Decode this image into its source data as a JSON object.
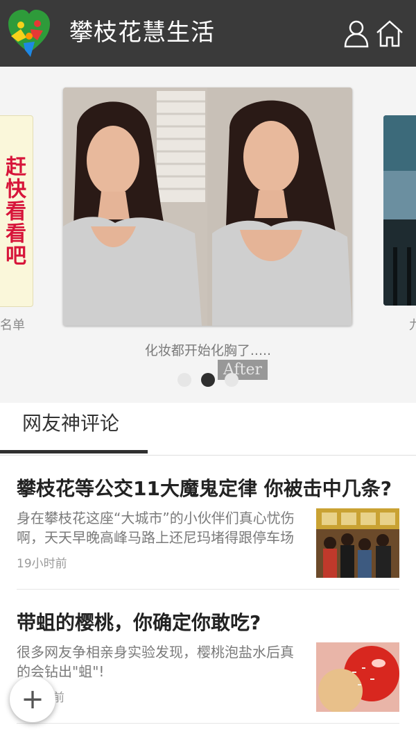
{
  "header": {
    "title": "攀枝花慧生活",
    "logo_icon": "family-heart-logo",
    "user_icon": "user-icon",
    "home_icon": "home-icon",
    "background": "#3a3a3a"
  },
  "banner": {
    "left_card": {
      "text": "赶快看看吧",
      "caption": "名单"
    },
    "main_card": {
      "image": "before-after-woman-photo",
      "after_label": "After",
      "caption": "化妆都开始化胸了....."
    },
    "right_card": {
      "caption": "九"
    },
    "dots": [
      false,
      true,
      false
    ]
  },
  "tabs": [
    {
      "label": "网友神评论",
      "active": true
    }
  ],
  "articles": [
    {
      "title": "攀枝花等公交11大魔鬼定律 你被击中几条?",
      "desc": "身在攀枝花这座“大城市”的小伙伴们真心忧伤啊，天天早晚高峰马路上还尼玛堵得跟停车场",
      "time": "19小时前",
      "thumb": "crowded-bus-photo"
    },
    {
      "title": "带蛆的樱桃，你确定你敢吃?",
      "desc": "很多网友争相亲身实验发现，樱桃泡盐水后真的会钻出\"蛆\"!",
      "time": "前",
      "thumb": "cherry-photo"
    }
  ],
  "fab": {
    "label": "+"
  }
}
